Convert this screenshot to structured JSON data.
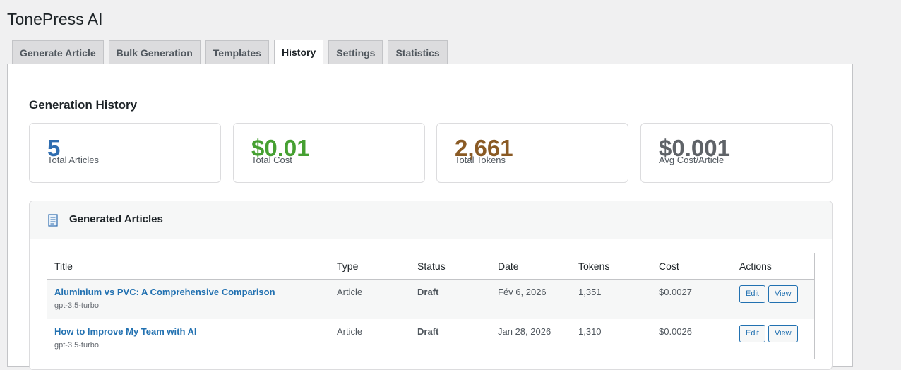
{
  "app": {
    "title": "TonePress AI"
  },
  "tabs": [
    {
      "label": "Generate Article"
    },
    {
      "label": "Bulk Generation"
    },
    {
      "label": "Templates"
    },
    {
      "label": "History",
      "active": true
    },
    {
      "label": "Settings"
    },
    {
      "label": "Statistics"
    }
  ],
  "history": {
    "title": "Generation History",
    "stats": [
      {
        "value": "5",
        "label": "Total Articles",
        "color": "#2f6db0"
      },
      {
        "value": "$0.01",
        "label": "Total Cost",
        "color": "#46a032"
      },
      {
        "value": "2,661",
        "label": "Total Tokens",
        "color": "#8a5a24"
      },
      {
        "value": "$0.001",
        "label": "Avg Cost/Article",
        "color": "#5f6368"
      }
    ],
    "articles": {
      "title": "Generated Articles",
      "icon": "document-icon",
      "columns": [
        "Title",
        "Type",
        "Status",
        "Date",
        "Tokens",
        "Cost",
        "Actions"
      ],
      "rows": [
        {
          "title": "Aluminium vs PVC: A Comprehensive Comparison",
          "model": "gpt-3.5-turbo",
          "type": "Article",
          "status": "Draft",
          "date": "Fév 6, 2026",
          "tokens": "1,351",
          "cost": "$0.0027",
          "edit": "Edit",
          "view": "View"
        },
        {
          "title": "How to Improve My Team with AI",
          "model": "gpt-3.5-turbo",
          "type": "Article",
          "status": "Draft",
          "date": "Jan 28, 2026",
          "tokens": "1,310",
          "cost": "$0.0026",
          "edit": "Edit",
          "view": "View"
        }
      ]
    }
  }
}
